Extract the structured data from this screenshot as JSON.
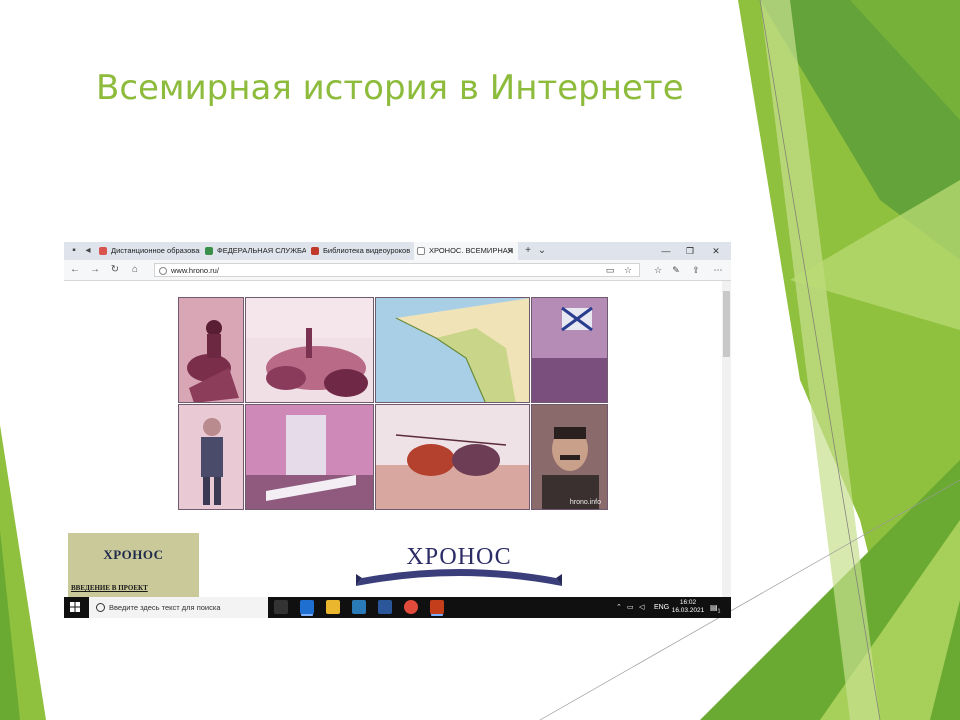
{
  "slide": {
    "title": "Всемирная история в Интернете"
  },
  "browser": {
    "tabs": [
      {
        "label": "Дистанционное образовани",
        "icon": "pdf-icon",
        "color": "#d9534f"
      },
      {
        "label": "ФЕДЕРАЛЬНАЯ СЛУЖБА П",
        "icon": "emblem-icon",
        "color": "#3a8f4a"
      },
      {
        "label": "Библиотека видеоуроков п",
        "icon": "video-icon",
        "color": "#c0392b"
      },
      {
        "label": "ХРОНОС. ВСЕМИРНАЯ",
        "icon": "page-icon",
        "color": "#888888",
        "active": true
      }
    ],
    "url": "www.hrono.ru/"
  },
  "page": {
    "watermark": "hrono.info",
    "side_box": {
      "title": "ХРОНОС",
      "link": "ВВЕДЕНИЕ В ПРОЕКТ"
    },
    "logo_text": "ХРОНОС"
  },
  "taskbar": {
    "search_placeholder": "Введите здесь текст для поиска",
    "language": "ENG",
    "time": "16:02",
    "date": "16.03.2021",
    "notification_count": "1"
  }
}
